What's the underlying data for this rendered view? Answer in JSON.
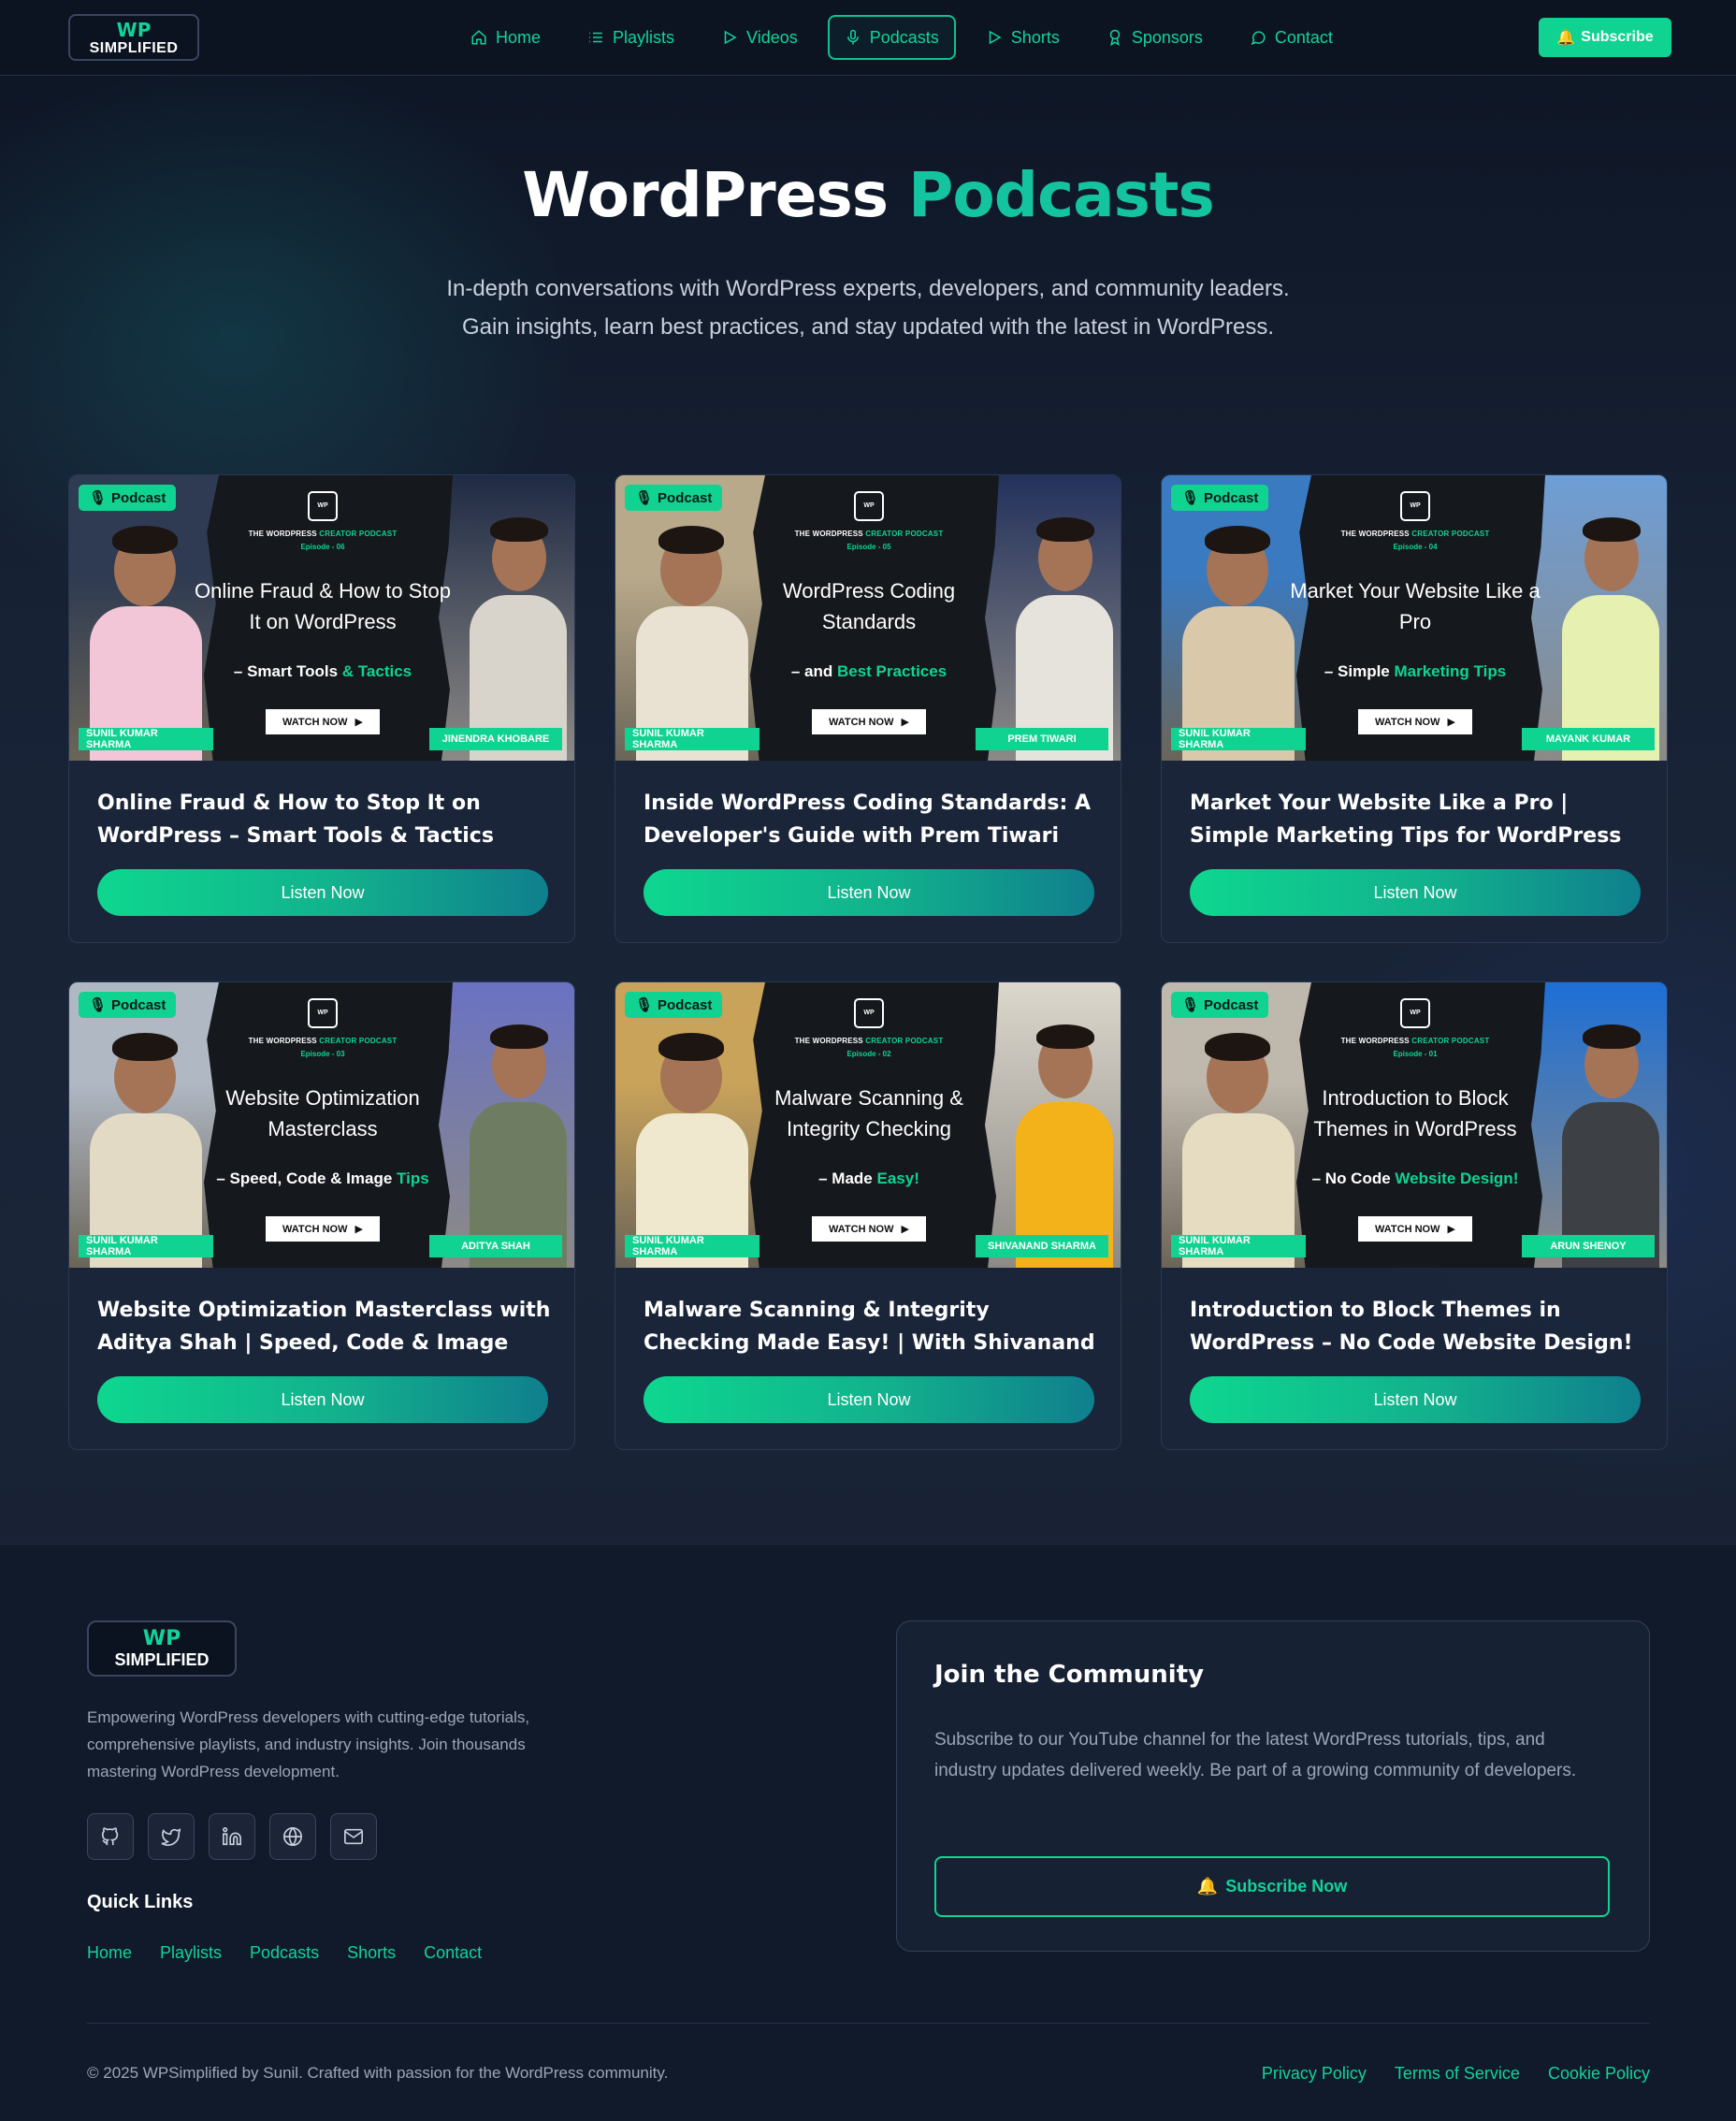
{
  "nav": {
    "logo_top": "WP",
    "logo_bottom": "SIMPLIFIED",
    "items": [
      {
        "label": "Home",
        "icon": "home-icon"
      },
      {
        "label": "Playlists",
        "icon": "list-icon"
      },
      {
        "label": "Videos",
        "icon": "play-icon"
      },
      {
        "label": "Podcasts",
        "icon": "microphone-icon",
        "active": true
      },
      {
        "label": "Shorts",
        "icon": "play-icon"
      },
      {
        "label": "Sponsors",
        "icon": "award-icon"
      },
      {
        "label": "Contact",
        "icon": "message-icon"
      }
    ],
    "subscribe": "Subscribe",
    "subscribe_icon": "🔔"
  },
  "hero": {
    "title_main": "WordPress",
    "title_accent": "Podcasts",
    "subtitle_1": "In-depth conversations with WordPress experts, developers, and community leaders.",
    "subtitle_2": "Gain insights, learn best practices, and stay updated with the latest in WordPress."
  },
  "cards": [
    {
      "badge": "Podcast",
      "series_a": "THE WORDPRESS",
      "series_b": "CREATOR PODCAST",
      "episode": "Episode - 06",
      "thumb_title": "Online Fraud & How to Stop It on WordPress",
      "thumb_sub_a": "– Smart Tools",
      "thumb_sub_b": "& Tactics",
      "watch": "WATCH NOW",
      "host": "SUNIL KUMAR SHARMA",
      "guest": "JINENDRA KHOBARE",
      "title": "Online Fraud & How to Stop It on WordPress – Smart Tools & Tactics",
      "cta": "Listen Now"
    },
    {
      "badge": "Podcast",
      "series_a": "THE WORDPRESS",
      "series_b": "CREATOR PODCAST",
      "episode": "Episode - 05",
      "thumb_title": "WordPress Coding Standards",
      "thumb_sub_a": "– and",
      "thumb_sub_b": "Best Practices",
      "watch": "WATCH NOW",
      "host": "SUNIL KUMAR SHARMA",
      "guest": "PREM TIWARI",
      "title": "Inside WordPress Coding Standards: A Developer's Guide with Prem Tiwari",
      "cta": "Listen Now"
    },
    {
      "badge": "Podcast",
      "series_a": "THE WORDPRESS",
      "series_b": "CREATOR PODCAST",
      "episode": "Episode - 04",
      "thumb_title": "Market Your Website Like a Pro",
      "thumb_sub_a": "– Simple",
      "thumb_sub_b": "Marketing Tips",
      "watch": "WATCH NOW",
      "host": "SUNIL KUMAR SHARMA",
      "guest": "MAYANK KUMAR",
      "title": "Market Your Website Like a Pro | Simple Marketing Tips for WordPress Users by...",
      "cta": "Listen Now"
    },
    {
      "badge": "Podcast",
      "series_a": "THE WORDPRESS",
      "series_b": "CREATOR PODCAST",
      "episode": "Episode - 03",
      "thumb_title": "Website Optimization Masterclass",
      "thumb_sub_a": "– Speed, Code & Image",
      "thumb_sub_b": "Tips",
      "watch": "WATCH NOW",
      "host": "SUNIL KUMAR SHARMA",
      "guest": "ADITYA SHAH",
      "title": "Website Optimization Masterclass with Aditya Shah | Speed, Code & Image Tips fo...",
      "cta": "Listen Now"
    },
    {
      "badge": "Podcast",
      "series_a": "THE WORDPRESS",
      "series_b": "CREATOR PODCAST",
      "episode": "Episode - 02",
      "thumb_title": "Malware Scanning & Integrity Checking",
      "thumb_sub_a": "– Made",
      "thumb_sub_b": "Easy!",
      "watch": "WATCH NOW",
      "host": "SUNIL KUMAR SHARMA",
      "guest": "SHIVANAND SHARMA",
      "title": "Malware Scanning & Integrity Checking Made Easy! | With Shivanand Sharma",
      "cta": "Listen Now"
    },
    {
      "badge": "Podcast",
      "series_a": "THE WORDPRESS",
      "series_b": "CREATOR PODCAST",
      "episode": "Episode - 01",
      "thumb_title": "Introduction to Block Themes in WordPress",
      "thumb_sub_a": "– No Code",
      "thumb_sub_b": "Website Design!",
      "watch": "WATCH NOW",
      "host": "SUNIL KUMAR SHARMA",
      "guest": "ARUN SHENOY",
      "title": "Introduction to Block Themes in WordPress – No Code Website Design! |...",
      "cta": "Listen Now"
    }
  ],
  "footer": {
    "logo_top": "WP",
    "logo_bottom": "SIMPLIFIED",
    "description": "Empowering WordPress developers with cutting-edge tutorials, comprehensive playlists, and industry insights. Join thousands mastering WordPress development.",
    "socials": [
      "github-icon",
      "twitter-icon",
      "linkedin-icon",
      "globe-icon",
      "mail-icon"
    ],
    "quick_links_title": "Quick Links",
    "quick_links": [
      "Home",
      "Playlists",
      "Podcasts",
      "Shorts",
      "Contact"
    ],
    "community_title": "Join the Community",
    "community_text": "Subscribe to our YouTube channel for the latest WordPress tutorials, tips, and industry updates delivered weekly. Be part of a growing community of developers.",
    "community_button": "Subscribe Now",
    "community_button_icon": "🔔",
    "copyright": "© 2025 WPSimplified by Sunil. Crafted with passion for the WordPress community.",
    "legal": [
      "Privacy Policy",
      "Terms of Service",
      "Cookie Policy"
    ]
  },
  "colors": {
    "accent": "#10d391",
    "background": "#172235",
    "card": "#1b263a"
  }
}
